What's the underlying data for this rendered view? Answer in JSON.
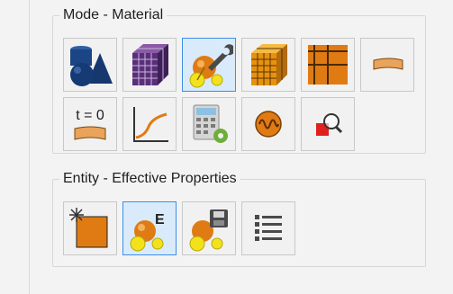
{
  "mode_group": {
    "title": "Mode - Material",
    "buttons": [
      {
        "icon": "geometry-shapes-icon",
        "active": false
      },
      {
        "icon": "mesh-cube-icon",
        "active": false
      },
      {
        "icon": "material-tool-icon",
        "active": true
      },
      {
        "icon": "voxel-cube-icon",
        "active": false
      },
      {
        "icon": "grid-icon",
        "active": false
      },
      {
        "icon": "section-bar-icon",
        "active": false
      },
      {
        "icon": "time-step-icon",
        "active": false,
        "label": "t = 0"
      },
      {
        "icon": "curve-plot-icon",
        "active": false
      },
      {
        "icon": "calculator-icon",
        "active": false
      },
      {
        "icon": "oscillation-icon",
        "active": false
      },
      {
        "icon": "inspect-icon",
        "active": false
      }
    ]
  },
  "entity_group": {
    "title": "Entity - Effective Properties",
    "buttons": [
      {
        "icon": "new-entity-icon",
        "active": false
      },
      {
        "icon": "effective-property-icon",
        "active": true,
        "label": "E"
      },
      {
        "icon": "save-property-icon",
        "active": false
      },
      {
        "icon": "list-icon",
        "active": false
      }
    ]
  },
  "colors": {
    "accent": "#3d8ee4",
    "active_bg": "#d9ebfb",
    "orange": "#e07b14",
    "navy": "#163a73",
    "yellow": "#f3e21b"
  }
}
